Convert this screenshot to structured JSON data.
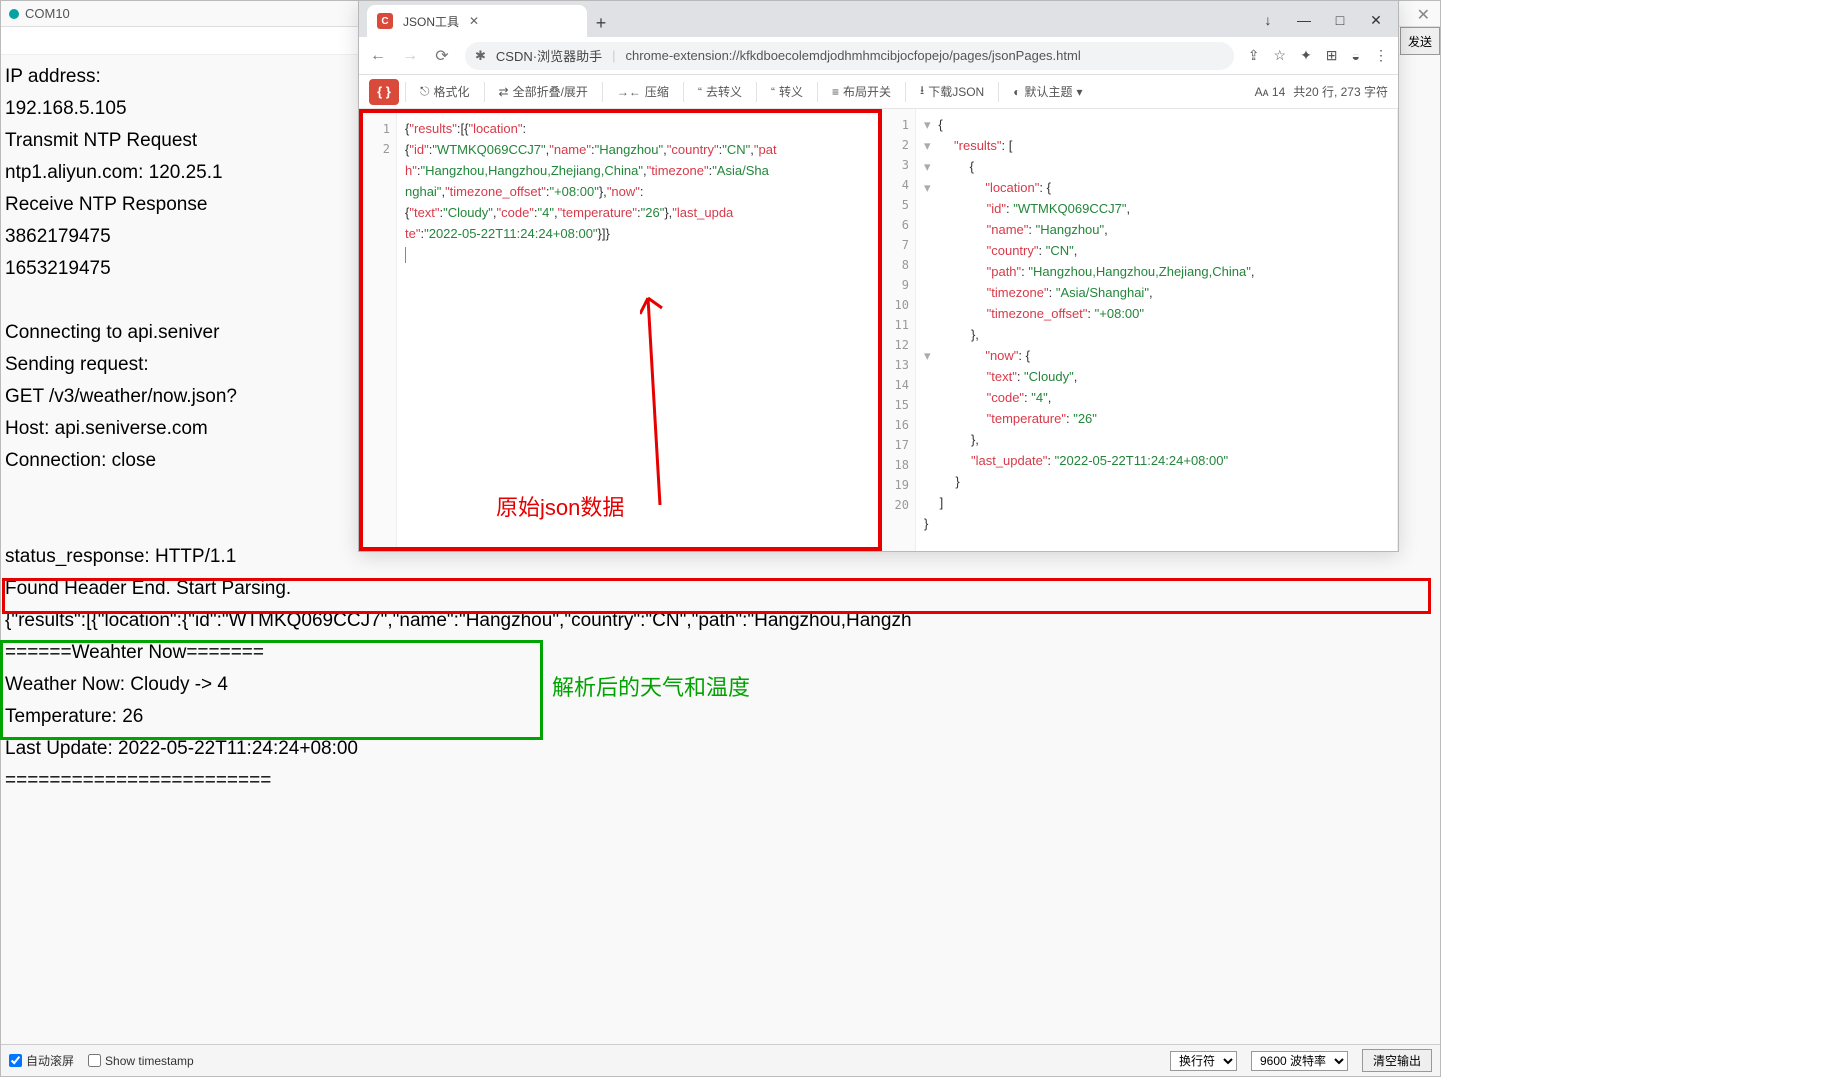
{
  "serial": {
    "title": "COM10",
    "send_btn": "发送",
    "lines_pre": "IP address:\n192.168.5.105\nTransmit NTP Request\nntp1.aliyun.com: 120.25.1\nReceive NTP Response\n3862179475\n1653219475\n\nConnecting to api.seniver\nSending request:\nGET /v3/weather/now.json?\nHost: api.seniverse.com\nConnection: close\n\n\nstatus_response: HTTP/1.1\nFound Header End. Start Parsing.",
    "json_line": "{\"results\":[{\"location\":{\"id\":\"WTMKQ069CCJ7\",\"name\":\"Hangzhou\",\"country\":\"CN\",\"path\":\"Hangzhou,Hangzh",
    "lines_post": "======Weahter Now=======\nWeather Now: Cloudy -> 4\nTemperature: 26\nLast Update: 2022-05-22T11:24:24+08:00\n========================",
    "footer": {
      "autoscroll": "自动滚屏",
      "show_ts": "Show timestamp",
      "line_ending": "换行符",
      "baud": "9600 波特率",
      "clear": "清空输出"
    }
  },
  "browser": {
    "tab_title": "JSON工具",
    "csdn_label": "CSDN·浏览器助手",
    "url": "chrome-extension://kfkdboecolemdjodhmhmcibjocfopejo/pages/jsonPages.html",
    "win": {
      "restore_down": "↓",
      "min": "—",
      "max": "□",
      "close": "✕"
    },
    "toolbar": {
      "format": "格式化",
      "fold": "全部折叠/展开",
      "compress": "压缩",
      "unescape": "去转义",
      "escape": "转义",
      "layout": "布局开关",
      "download": "下载JSON",
      "theme": "默认主题",
      "font_size": "14",
      "stats": "共20 行,  273 字符"
    }
  },
  "json_left_gutter": [
    "1",
    "2"
  ],
  "json_right_gutter": [
    "1",
    "2",
    "3",
    "4",
    "5",
    "6",
    "7",
    "8",
    "9",
    "10",
    "11",
    "12",
    "13",
    "14",
    "15",
    "16",
    "17",
    "18",
    "19",
    "20"
  ],
  "parsed": {
    "results_key": "results",
    "location_key": "location",
    "loc": {
      "id": "WTMKQ069CCJ7",
      "name": "Hangzhou",
      "country": "CN",
      "path": "Hangzhou,Hangzhou,Zhejiang,China",
      "timezone": "Asia/Shanghai",
      "timezone_offset": "+08:00"
    },
    "now": {
      "text": "Cloudy",
      "code": "4",
      "temperature": "26"
    },
    "last_update": "2022-05-22T11:24:24+08:00"
  },
  "annotations": {
    "raw_json": "原始json数据",
    "parsed_result": "解析后的天气和温度"
  }
}
